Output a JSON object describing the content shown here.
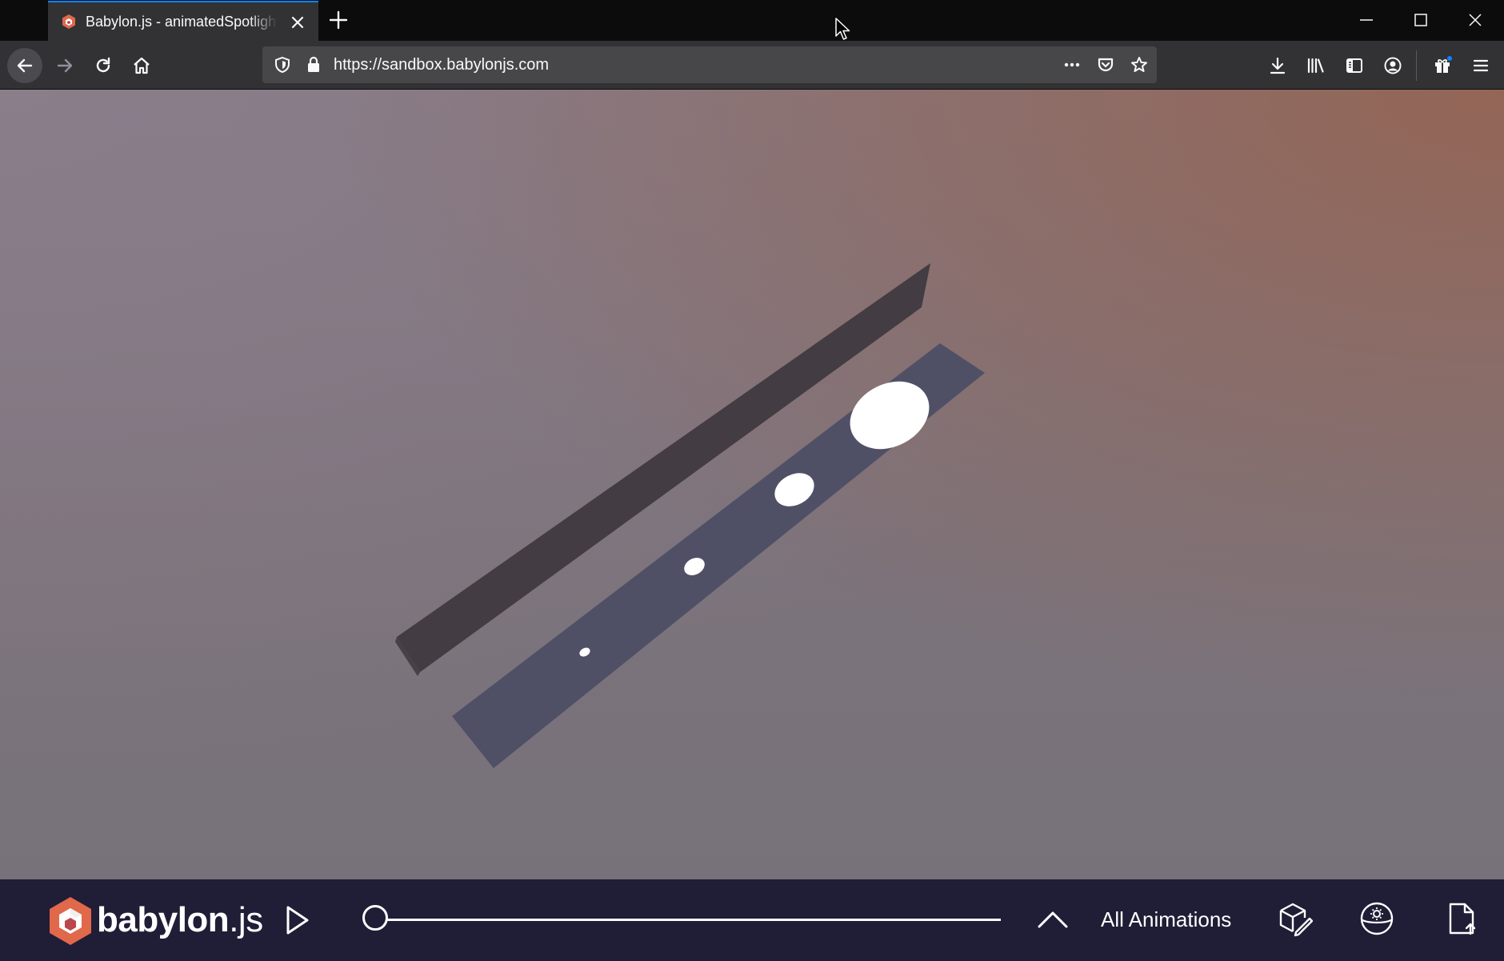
{
  "browser": {
    "tab": {
      "title": "Babylon.js - animatedSpotlight",
      "favicon": "babylon-favicon-icon"
    },
    "url": "https://sandbox.babylonjs.com",
    "icons": {
      "back": "arrow-left-icon",
      "forward": "arrow-right-icon",
      "reload": "reload-icon",
      "home": "home-icon",
      "shield": "tracking-shield-icon",
      "lock": "lock-icon",
      "more": "ellipsis-icon",
      "pocket": "pocket-icon",
      "bookmark": "star-icon",
      "downloads": "download-icon",
      "library": "library-icon",
      "sidebar": "sidebar-icon",
      "account": "account-icon",
      "extensions": "gift-icon",
      "menu": "hamburger-menu-icon"
    }
  },
  "sandbox": {
    "brand_name": "babylon",
    "brand_suffix": ".js",
    "animation_selector": "All Animations",
    "timeline_progress": 0.0,
    "icons": {
      "play": "play-icon",
      "expand": "chevron-up-icon",
      "inspector": "inspector-cube-icon",
      "environment": "environment-globe-icon",
      "upload": "file-upload-icon"
    }
  },
  "colors": {
    "accent_blue": "#0a84ff",
    "footer_bg": "#201d36",
    "babylon_red": "#e0684b",
    "wall": "#433c42",
    "floor": "#4f5066",
    "spot": "#ffffff"
  }
}
